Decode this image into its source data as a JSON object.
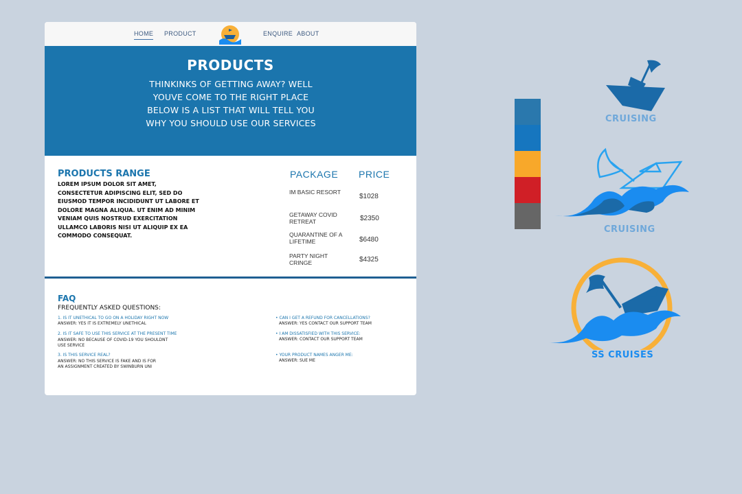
{
  "nav": {
    "home": "HOME",
    "product": "PRODUCT",
    "enquire": "ENQUIRE",
    "about": "ABOUT"
  },
  "hero": {
    "title": "PRODUCTS",
    "subtitle": "THINKINKS OF GETTING AWAY? WELL YOUVE COME TO THE RIGHT PLACE BELOW IS A LIST THAT WILL TELL YOU WHY YOU SHOULD USE OUR SERVICES"
  },
  "range": {
    "title": "PRODUCTS RANGE",
    "text": "LOREM IPSUM DOLOR SIT AMET, CONSECTETUR ADIPISCING ELIT, SED DO EIUSMOD TEMPOR INCIDIDUNT UT LABORE ET DOLORE MAGNA ALIQUA. UT ENIM AD MINIM VENIAM QUIS NOSTRUD EXERCITATION ULLAMCO LABORIS NISI UT ALIQUIP EX EA COMMODO CONSEQUAT."
  },
  "table": {
    "headers": [
      "PACKAGE",
      "PRICE"
    ],
    "rows": [
      {
        "package": "IM BASIC RESORT",
        "price": "$1028"
      },
      {
        "package": "GETAWAY COVID RETREAT",
        "price": "$2350"
      },
      {
        "package": "QUARANTINE OF A LIFETIME",
        "price": "$6480"
      },
      {
        "package": "PARTY NIGHT CRINGE",
        "price": "$4325"
      }
    ]
  },
  "faq": {
    "title": "FAQ",
    "subtitle": "FREQUENTLY ASKED QUESTIONS:",
    "left": [
      {
        "q": "1. IS IT UNETHICAL TO GO ON A HOLIDAY RIGHT NOW",
        "a": "ANSWER: YES IT IS EXTREMELY UNETHICAL"
      },
      {
        "q": "2. IS IT SAFE TO USE THIS SERVICE AT THE PRESENT TIME",
        "a": "ANSWER: NO BECAUSE OF COVID-19 YOU SHOULDNT USE SERVICE"
      },
      {
        "q": "3. IS THIS SERVICE REAL?",
        "a": "ANSWER: NO THIS SERVICE IS FAKE AND IS FOR AN ASSIGNMENT CREATED BY SWINBURN UNI"
      }
    ],
    "right": [
      {
        "q": "• CAN I GET A REFUND FOR CANCELLATIONS?",
        "a": "ANSWER: YES CONTACT OUR SUPPORT TEAM"
      },
      {
        "q": "• I AM DISSATISFIED WITH THIS SERVICE:",
        "a": "ANSWER: CONTACT OUR SUPPORT TEAM"
      },
      {
        "q": "• YOUR PRODUCT NAMES ANGER ME:",
        "a": "ANSWER: SUE ME"
      }
    ]
  },
  "palette": [
    "#2a78ad",
    "#1676bf",
    "#f8a82a",
    "#d01f26",
    "#666666"
  ],
  "branding": {
    "label1": "CRUISING",
    "label2": "CRUISING",
    "label3": "SS CRUISES"
  },
  "colors": {
    "hero_blue": "#1b75ad",
    "wave_blue": "#1a8cf0",
    "sun_orange": "#f8b038",
    "label_light": "#6fa8da"
  }
}
